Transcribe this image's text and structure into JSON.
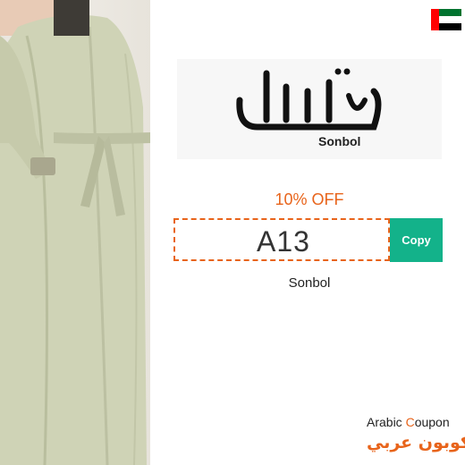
{
  "photo": {
    "alt": "Model wearing light green abaya"
  },
  "flag": {
    "country": "United Arab Emirates",
    "colors": [
      "#00732f",
      "#ffffff",
      "#000000",
      "#ff0000"
    ]
  },
  "logo": {
    "arabic_mark": "سنبل",
    "name": "Sonbol"
  },
  "offer": {
    "discount": "10% OFF",
    "code": "A13",
    "copy_label": "Copy",
    "brand": "Sonbol"
  },
  "watermark": {
    "en_prefix": "Arabic ",
    "en_accent": "C",
    "en_suffix": "oupon",
    "ar": "كوبون عربي"
  },
  "colors": {
    "accent": "#e8641b",
    "button": "#13b28a"
  }
}
